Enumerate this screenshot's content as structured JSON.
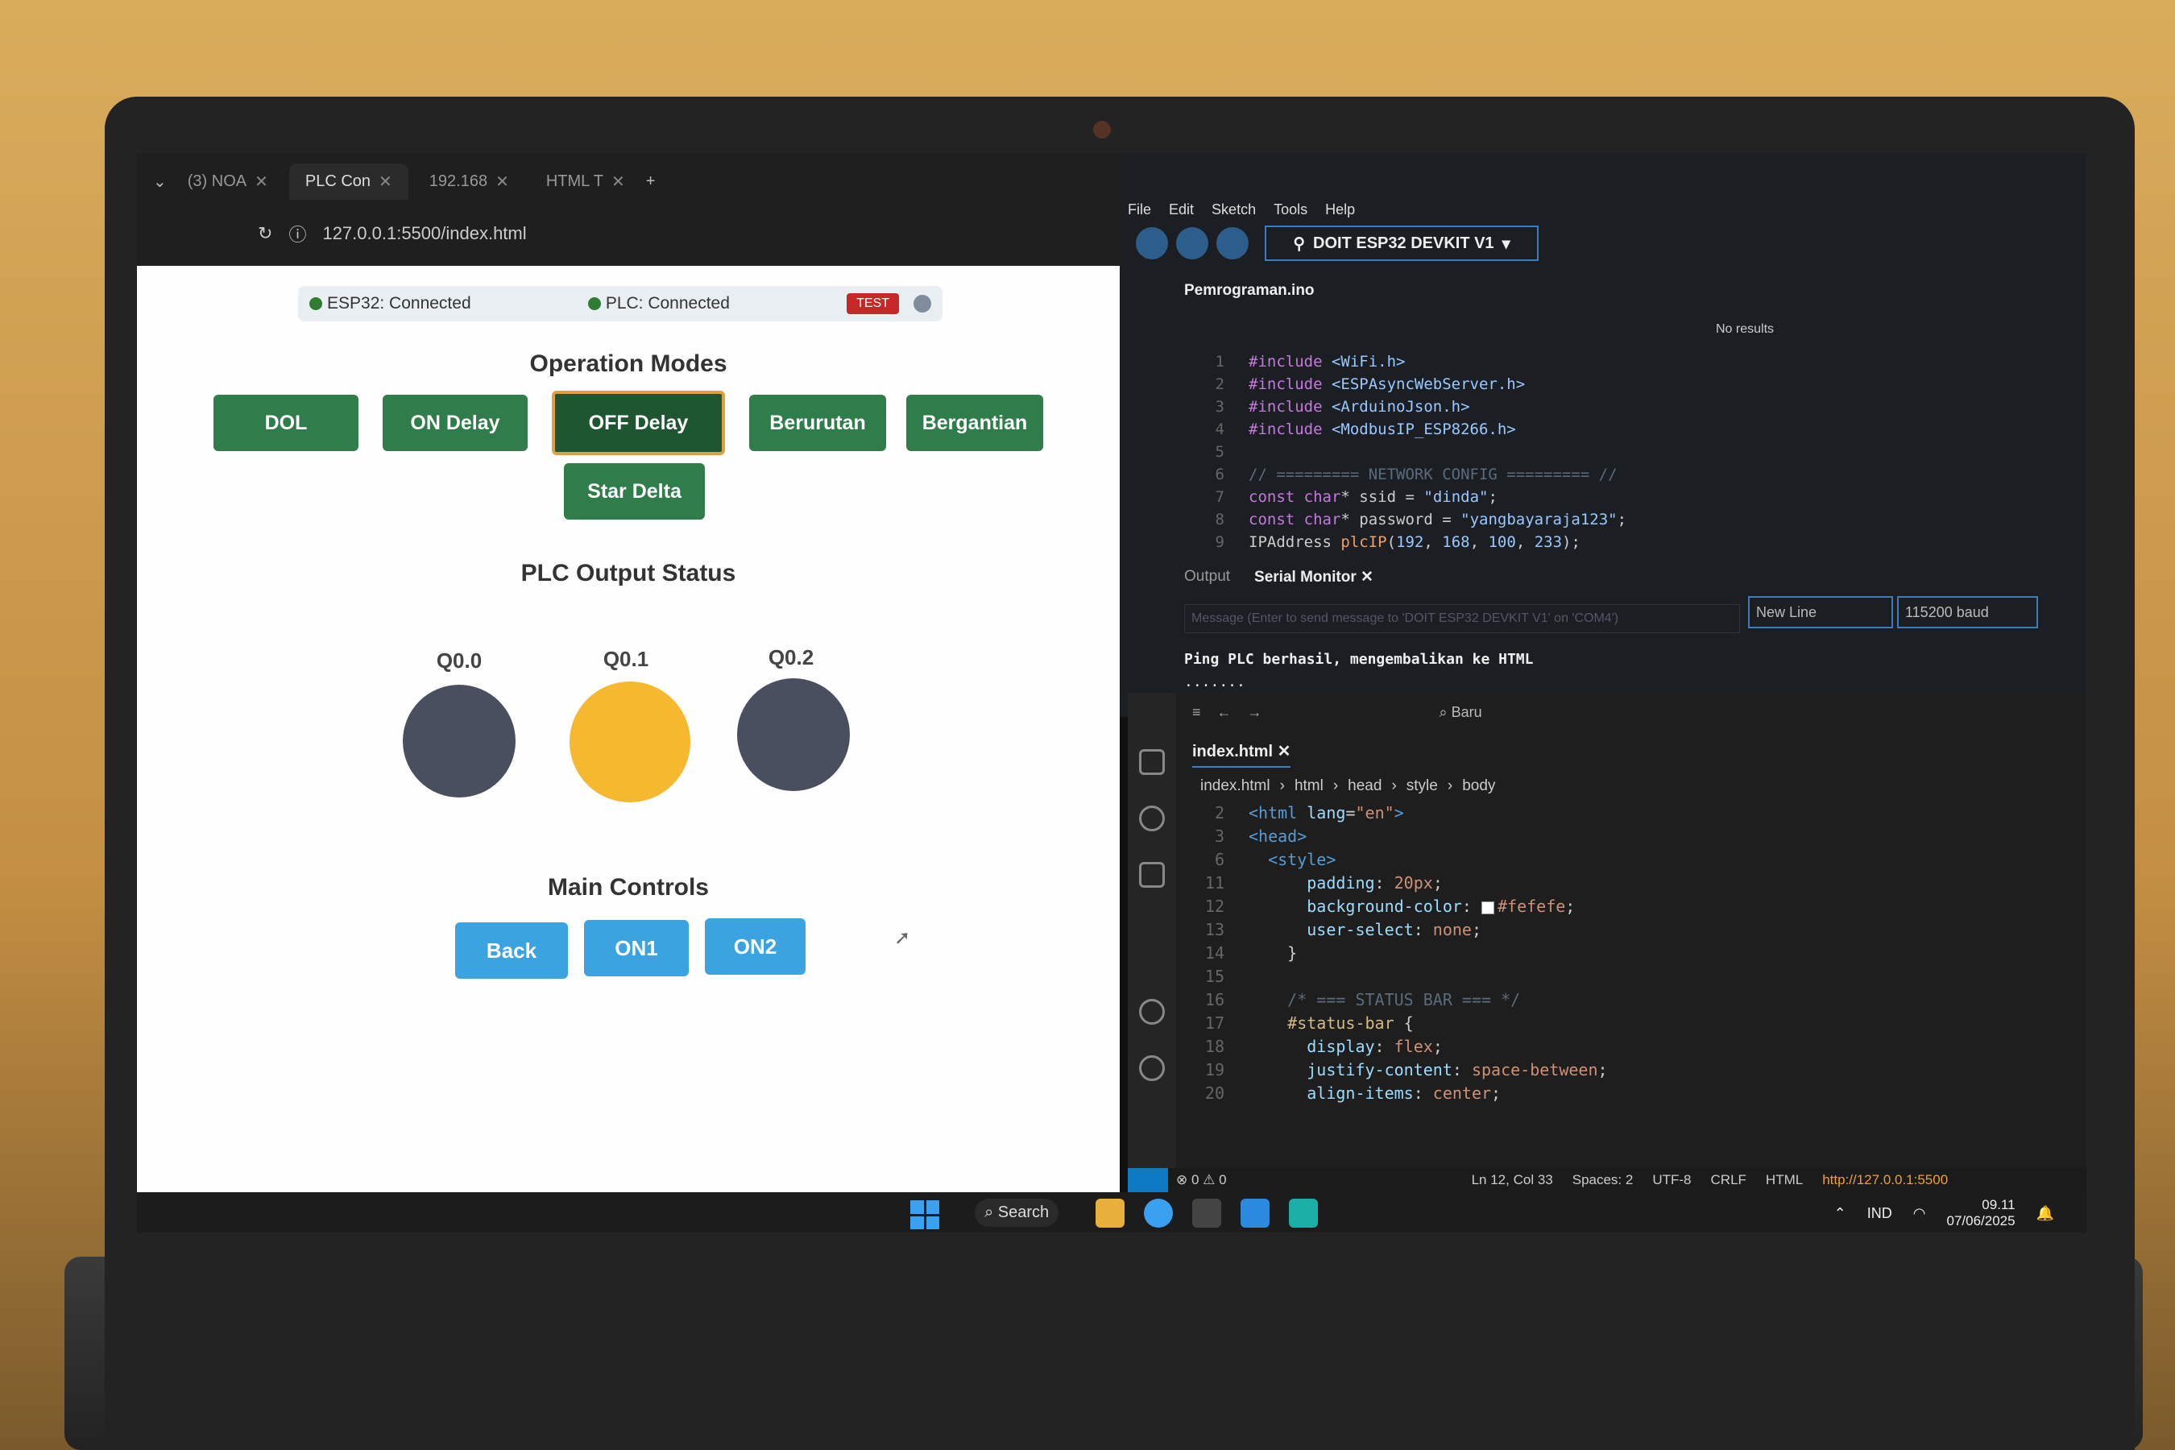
{
  "browser": {
    "tabs": [
      "(3) NOA",
      "PLC Con",
      "192.168",
      "HTML T"
    ],
    "address": "127.0.0.1:5500/index.html"
  },
  "page": {
    "status_esp32": "ESP32: Connected",
    "status_plc": "PLC: Connected",
    "test_label": "TEST",
    "modes_title": "Operation Modes",
    "modes": [
      "DOL",
      "ON Delay",
      "OFF Delay",
      "Berurutan",
      "Bergantian",
      "Star Delta"
    ],
    "active_mode": "OFF Delay",
    "outputs_title": "PLC Output Status",
    "outputs": [
      {
        "label": "Q0.0",
        "on": false
      },
      {
        "label": "Q0.1",
        "on": true
      },
      {
        "label": "Q0.2",
        "on": false
      }
    ],
    "controls_title": "Main Controls",
    "controls": [
      "Back",
      "ON1",
      "ON2"
    ]
  },
  "arduino": {
    "menu": [
      "File",
      "Edit",
      "Sketch",
      "Tools",
      "Help"
    ],
    "board": "DOIT ESP32 DEVKIT V1",
    "file": "Pemrograman.ino",
    "find_result": "No results",
    "serial_tabs": [
      "Output",
      "Serial Monitor"
    ],
    "serial_placeholder": "Message (Enter to send message to 'DOIT ESP32 DEVKIT V1' on 'COM4')",
    "line_ending": "New Line",
    "baud": "115200 baud",
    "serial_output": [
      "Ping PLC berhasil, mengembalikan ke HTML",
      "......."
    ]
  },
  "vscode": {
    "search": "Baru",
    "tab": "index.html",
    "breadcrumb": [
      "index.html",
      "html",
      "head",
      "style",
      "body"
    ],
    "status": {
      "errors": "0",
      "warnings": "0",
      "position": "Ln 12, Col 33",
      "spaces": "Spaces: 2",
      "encoding": "UTF-8",
      "eol": "CRLF",
      "language": "HTML",
      "server": "http://127.0.0.1:5500"
    }
  },
  "taskbar": {
    "search": "Search",
    "lang": "IND",
    "time": "09.11",
    "date": "07/06/2025"
  },
  "colors": {
    "mode_button": "#2e7d4a",
    "lamp_off": "#4a4f5f",
    "lamp_on": "#f5b82e",
    "control_button": "#3aa3e0"
  }
}
